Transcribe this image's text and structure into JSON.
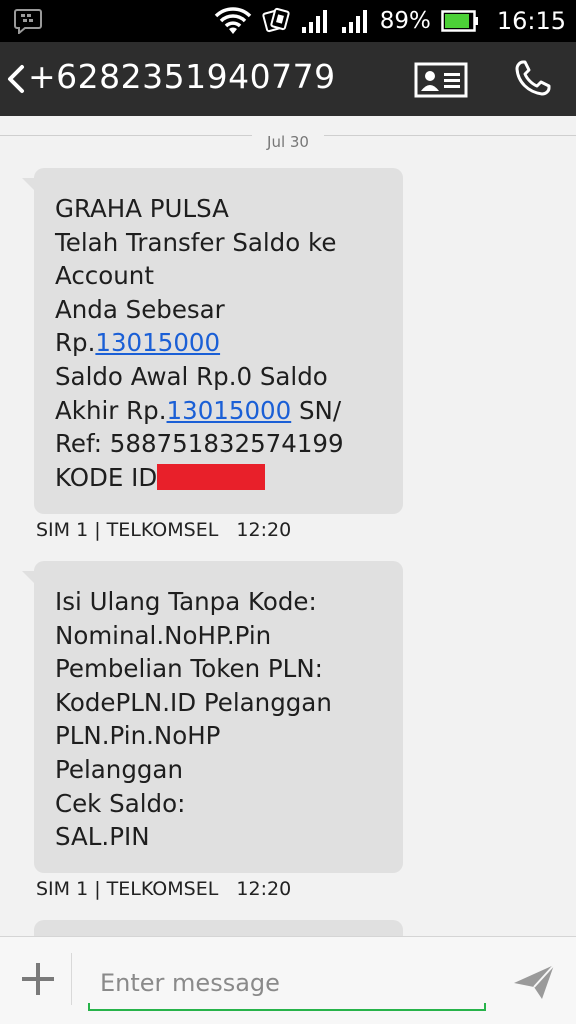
{
  "status_bar": {
    "battery_percent_label": "89%",
    "battery_level": 0.89,
    "time": "16:15",
    "icons": [
      "bbm-icon",
      "wifi-icon",
      "sim-toggle-icon",
      "signal-sim1-icon",
      "signal-sim2-icon",
      "battery-icon"
    ]
  },
  "header": {
    "title": "+6282351940779",
    "icons": [
      "back-icon",
      "contact-card-icon",
      "phone-icon"
    ]
  },
  "thread": {
    "date": "Jul 30",
    "messages": [
      {
        "lines": [
          "GRAHA PULSA",
          "Telah Transfer Saldo ke",
          "Account",
          "Anda Sebesar",
          "Rp.",
          "13015000",
          "Saldo Awal Rp.0 Saldo",
          "Akhir Rp.",
          "13015000",
          " SN/",
          "Ref: 588751832574199",
          "KODE ID"
        ],
        "sim": "SIM 1 |  TELKOMSEL",
        "time": "12:20"
      },
      {
        "lines": [
          "Isi Ulang Tanpa Kode:",
          "Nominal.NoHP.Pin",
          "Pembelian Token PLN:",
          "KodePLN.ID Pelanggan",
          "PLN.Pin.NoHP",
          "Pelanggan",
          "Cek Saldo:",
          "SAL.PIN"
        ],
        "sim": "SIM 1 |  TELKOMSEL",
        "time": "12:20"
      }
    ]
  },
  "compose": {
    "placeholder": "Enter message",
    "icons": [
      "plus-icon",
      "send-icon"
    ]
  },
  "colors": {
    "status_bar_bg": "#000000",
    "action_bar_bg": "#2d2d2d",
    "bubble_bg": "#e0e0e0",
    "link": "#1a5fd6",
    "input_accent": "#27b34a",
    "battery": "#4cd137",
    "redaction": "#e8202a"
  }
}
